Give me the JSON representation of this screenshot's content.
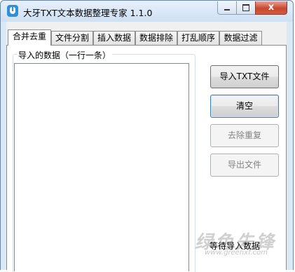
{
  "window": {
    "title": "大牙TXT文本数据整理专家 1.1.0",
    "close_glyph": "x"
  },
  "tabs": [
    {
      "label": "合并去重",
      "active": true
    },
    {
      "label": "文件分割",
      "active": false
    },
    {
      "label": "插入数据",
      "active": false
    },
    {
      "label": "数据排除",
      "active": false
    },
    {
      "label": "打乱顺序",
      "active": false
    },
    {
      "label": "数据过滤",
      "active": false
    }
  ],
  "group": {
    "legend": "导入的数据（一行一条）"
  },
  "buttons": {
    "import_txt": "导入TXT文件",
    "clear": "清空",
    "dedupe": "去除重复",
    "export": "导出文件"
  },
  "status_text": "等待导入数据",
  "watermark": {
    "text": "绿色先锋",
    "url": "www.greenxf.com"
  },
  "colors": {
    "accent": "#2f8fd8",
    "close_button": "#c8482f",
    "disabled_text": "#838383"
  },
  "icons": {
    "app": "app-tooth-icon",
    "minimize": "minimize-icon",
    "maximize": "maximize-icon",
    "close": "close-icon"
  }
}
